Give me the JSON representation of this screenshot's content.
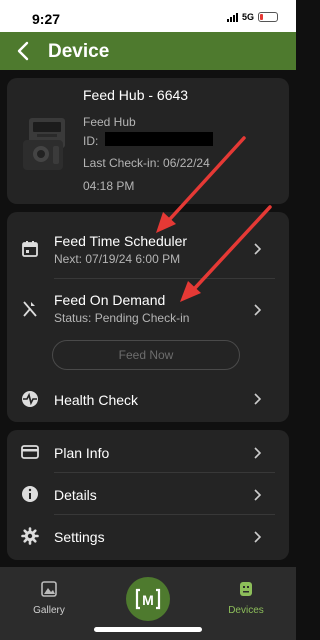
{
  "status_bar": {
    "time": "9:27",
    "network": "5G"
  },
  "header": {
    "title": "Device"
  },
  "device": {
    "name": "Feed Hub - 6643",
    "type": "Feed Hub",
    "id_label": "ID:",
    "last_checkin_line1": "Last Check-in: 06/22/24",
    "last_checkin_line2": "04:18 PM"
  },
  "feeding": {
    "scheduler_label": "Feed Time Scheduler",
    "scheduler_next": "Next: 07/19/24 6:00 PM",
    "on_demand_label": "Feed On Demand",
    "on_demand_status": "Status: Pending Check-in",
    "feed_now_label": "Feed Now",
    "health_check_label": "Health Check"
  },
  "menu": {
    "plan_info_label": "Plan Info",
    "details_label": "Details",
    "settings_label": "Settings"
  },
  "tabs": {
    "gallery_label": "Gallery",
    "center_logo": "M",
    "devices_label": "Devices"
  },
  "colors": {
    "brand_green": "#4e7a2e",
    "active_tab": "#8dbe5a",
    "annotation_red": "#e53935"
  }
}
